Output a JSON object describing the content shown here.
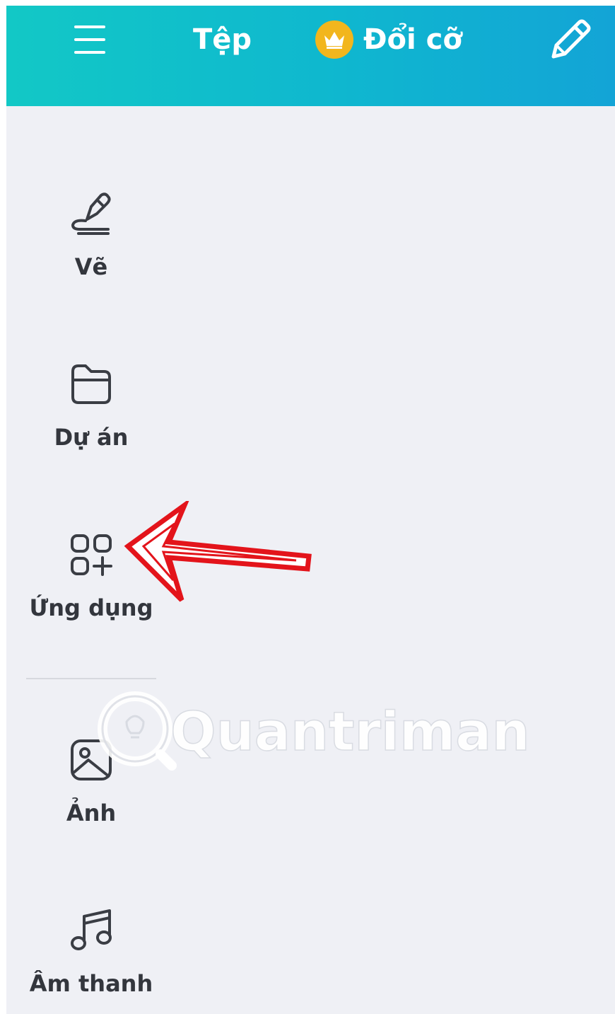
{
  "topbar": {
    "menu_icon": "hamburger-menu-icon",
    "file_label": "Tệp",
    "resize_label": "Đổi cỡ",
    "resize_icon": "crown-icon",
    "edit_icon": "pencil-icon",
    "gradient_start": "#12c8c6",
    "gradient_end": "#13a4d6",
    "crown_color": "#f2b61d"
  },
  "sidebar": {
    "items": [
      {
        "label": "Vẽ",
        "icon": "draw-pen-icon"
      },
      {
        "label": "Dự án",
        "icon": "folder-icon"
      },
      {
        "label": "Ứng dụng",
        "icon": "apps-grid-add-icon"
      },
      {
        "label": "Ảnh",
        "icon": "image-icon"
      },
      {
        "label": "Âm thanh",
        "icon": "music-note-icon"
      }
    ]
  },
  "annotation": {
    "arrow_color": "#e3141b",
    "arrow_target": "Ứng dụng"
  },
  "watermark": {
    "text": "Quantrimang"
  }
}
